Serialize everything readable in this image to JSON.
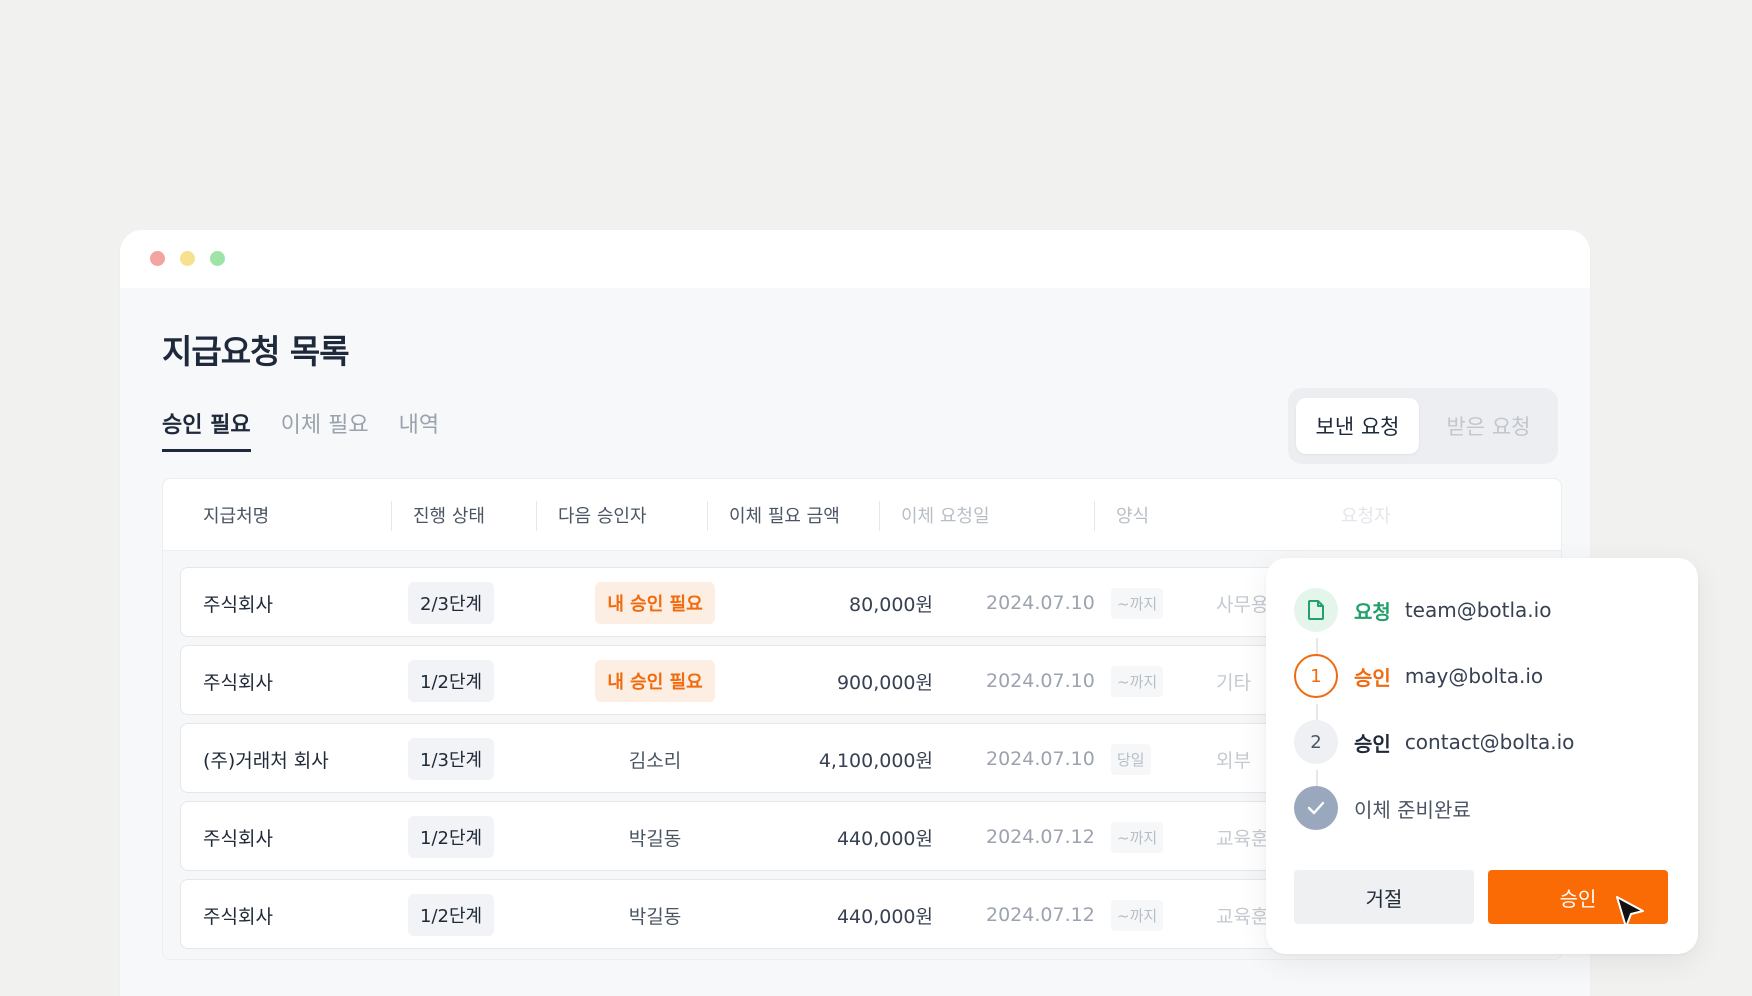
{
  "page": {
    "title": "지급요청 목록",
    "tabs": [
      {
        "label": "승인 필요",
        "active": true
      },
      {
        "label": "이체 필요",
        "active": false
      },
      {
        "label": "내역",
        "active": false
      }
    ],
    "segment": [
      {
        "label": "보낸 요청",
        "active": true
      },
      {
        "label": "받은 요청",
        "active": false
      }
    ]
  },
  "table": {
    "headers": [
      "지급처명",
      "진행 상태",
      "다음 승인자",
      "이체 필요 금액",
      "이체 요청일",
      "양식",
      "요청자"
    ],
    "rows": [
      {
        "name": "주식회사",
        "stage": "2/3단계",
        "approver": "내 승인 필요",
        "approver_highlight": true,
        "amount": "80,000원",
        "date": "2024.07.10",
        "due": "~까지",
        "form": "사무용"
      },
      {
        "name": "주식회사",
        "stage": "1/2단계",
        "approver": "내 승인 필요",
        "approver_highlight": true,
        "amount": "900,000원",
        "date": "2024.07.10",
        "due": "~까지",
        "form": "기타"
      },
      {
        "name": "(주)거래처 회사",
        "stage": "1/3단계",
        "approver": "김소리",
        "approver_highlight": false,
        "amount": "4,100,000원",
        "date": "2024.07.10",
        "due": "당일",
        "form": "외부"
      },
      {
        "name": "주식회사",
        "stage": "1/2단계",
        "approver": "박길동",
        "approver_highlight": false,
        "amount": "440,000원",
        "date": "2024.07.12",
        "due": "~까지",
        "form": "교육훈"
      },
      {
        "name": "주식회사",
        "stage": "1/2단계",
        "approver": "박길동",
        "approver_highlight": false,
        "amount": "440,000원",
        "date": "2024.07.12",
        "due": "~까지",
        "form": "교육훈"
      }
    ]
  },
  "popup": {
    "steps": [
      {
        "role": "요청",
        "email": "team@botla.io",
        "state": "requested"
      },
      {
        "number": "1",
        "role": "승인",
        "email": "may@bolta.io",
        "state": "active"
      },
      {
        "number": "2",
        "role": "승인",
        "email": "contact@bolta.io",
        "state": "pending"
      },
      {
        "label": "이체 준비완료",
        "state": "done"
      }
    ],
    "reject_label": "거절",
    "approve_label": "승인"
  },
  "colors": {
    "accent": "#fa6a05",
    "accent_text": "#f06a0e",
    "request_green": "#23a06b"
  }
}
